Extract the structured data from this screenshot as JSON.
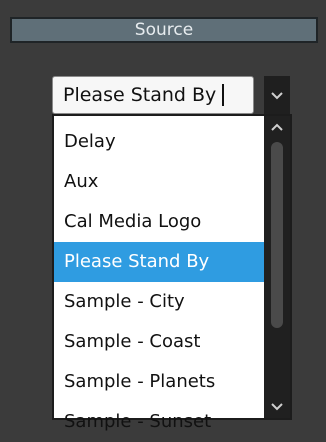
{
  "header": {
    "title": "Source"
  },
  "combo": {
    "value": "Please Stand By",
    "button_icon": "chevron-down-icon"
  },
  "dropdown": {
    "items": [
      {
        "label": "Delay"
      },
      {
        "label": "Aux"
      },
      {
        "label": "Cal Media Logo"
      },
      {
        "label": "Please Stand By",
        "selected": true
      },
      {
        "label": "Sample - City"
      },
      {
        "label": "Sample - Coast"
      },
      {
        "label": "Sample - Planets"
      },
      {
        "label": "Sample - Sunset"
      }
    ],
    "scroll_up_icon": "chevron-up-icon",
    "scroll_down_icon": "chevron-down-icon"
  },
  "colors": {
    "background": "#3b3b3b",
    "header_bg": "#5f6f78",
    "selection": "#2f9ce1"
  }
}
